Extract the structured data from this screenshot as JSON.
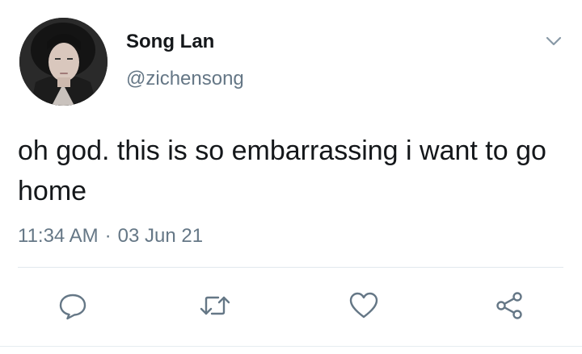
{
  "tweet": {
    "author": {
      "display_name": "Song Lan",
      "handle": "@zichensong",
      "avatar_icon": "profile-photo"
    },
    "text": "oh god. this is so embarrassing i want to go home",
    "time": "11:34 AM",
    "separator": "·",
    "date": "03 Jun 21",
    "menu_icon": "chevron-down-icon",
    "actions": [
      {
        "name": "reply",
        "icon": "speech-bubble-icon"
      },
      {
        "name": "retweet",
        "icon": "retweet-arrows-icon"
      },
      {
        "name": "like",
        "icon": "heart-icon"
      },
      {
        "name": "share",
        "icon": "share-nodes-icon"
      }
    ]
  },
  "colors": {
    "text": "#14171a",
    "secondary": "#657786",
    "icon": "#657786",
    "divider": "#e1e8ed",
    "background": "#ffffff"
  }
}
